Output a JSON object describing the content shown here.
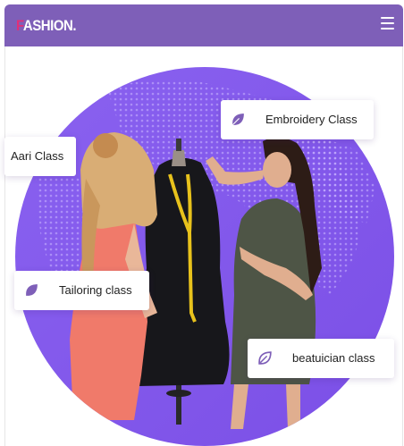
{
  "header": {
    "logo_first": "F",
    "logo_rest": "ASHION.",
    "menu_icon": "hamburger-icon"
  },
  "colors": {
    "header_bg": "#7e5fb8",
    "circle": "#8b5cf6",
    "accent_leaf": "#7e5fb8",
    "logo_accent": "#e0307a"
  },
  "hero": {
    "image_alt": "two women fitting a black dress on a tailor's mannequin",
    "cards": [
      {
        "label": "Embroidery Class",
        "icon": "leaf-icon"
      },
      {
        "label": "Aari Class",
        "icon": ""
      },
      {
        "label": "Tailoring class",
        "icon": "leaf-icon"
      },
      {
        "label": "beatuician class",
        "icon": "leaf-outline-icon"
      }
    ]
  }
}
